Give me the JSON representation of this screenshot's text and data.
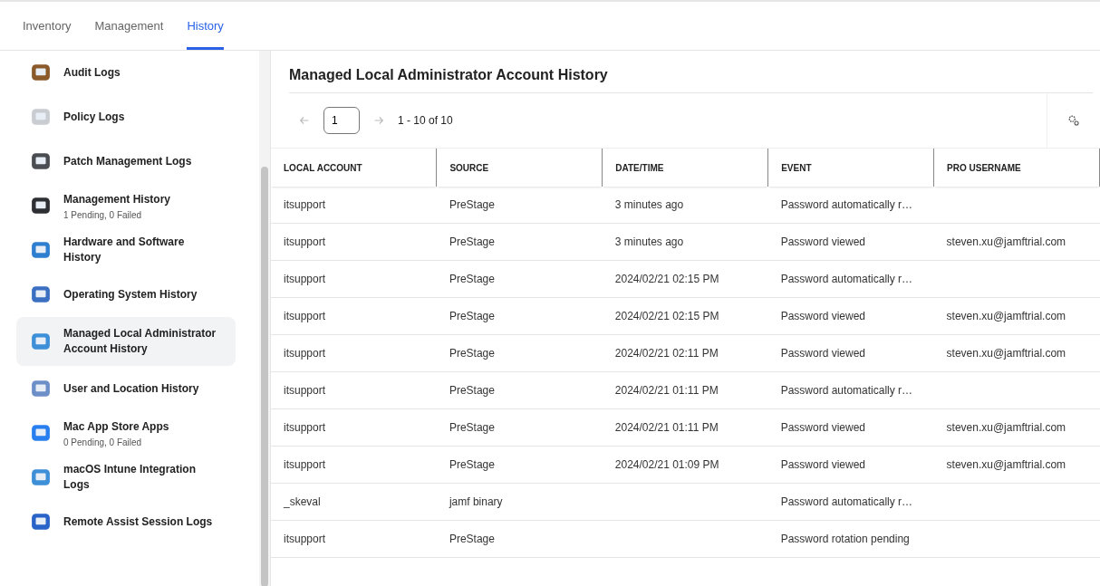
{
  "tabs": [
    {
      "label": "Inventory",
      "selected": false
    },
    {
      "label": "Management",
      "selected": false
    },
    {
      "label": "History",
      "selected": true
    }
  ],
  "sidebar": {
    "items": [
      {
        "label": "Audit Logs",
        "selected": false
      },
      {
        "label": "Policy Logs",
        "selected": false
      },
      {
        "label": "Patch Management Logs",
        "selected": false
      },
      {
        "label": "Management History",
        "subtitle": "1 Pending, 0 Failed",
        "selected": false
      },
      {
        "label": "Hardware and Software History",
        "selected": false
      },
      {
        "label": "Operating System History",
        "selected": false
      },
      {
        "label": "Managed Local Administrator Account History",
        "selected": true
      },
      {
        "label": "User and Location History",
        "selected": false
      },
      {
        "label": "Mac App Store Apps",
        "subtitle": "0 Pending, 0 Failed",
        "selected": false
      },
      {
        "label": "macOS Intune Integration Logs",
        "selected": false
      },
      {
        "label": "Remote Assist Session Logs",
        "selected": false
      }
    ]
  },
  "page_title": "Managed Local Administrator Account History",
  "pagination": {
    "page": "1",
    "range": "1 - 10 of 10"
  },
  "table": {
    "columns": [
      "LOCAL ACCOUNT",
      "SOURCE",
      "DATE/TIME",
      "EVENT",
      "PRO USERNAME"
    ],
    "rows": [
      [
        "itsupport",
        "PreStage",
        "3 minutes ago",
        "Password automatically r…",
        ""
      ],
      [
        "itsupport",
        "PreStage",
        "3 minutes ago",
        "Password viewed",
        "steven.xu@jamftrial.com"
      ],
      [
        "itsupport",
        "PreStage",
        "2024/02/21 02:15 PM",
        "Password automatically r…",
        ""
      ],
      [
        "itsupport",
        "PreStage",
        "2024/02/21 02:15 PM",
        "Password viewed",
        "steven.xu@jamftrial.com"
      ],
      [
        "itsupport",
        "PreStage",
        "2024/02/21 02:11 PM",
        "Password viewed",
        "steven.xu@jamftrial.com"
      ],
      [
        "itsupport",
        "PreStage",
        "2024/02/21 01:11 PM",
        "Password automatically r…",
        ""
      ],
      [
        "itsupport",
        "PreStage",
        "2024/02/21 01:11 PM",
        "Password viewed",
        "steven.xu@jamftrial.com"
      ],
      [
        "itsupport",
        "PreStage",
        "2024/02/21 01:09 PM",
        "Password viewed",
        "steven.xu@jamftrial.com"
      ],
      [
        "_skeval",
        "jamf binary",
        "",
        "Password automatically r…",
        ""
      ],
      [
        "itsupport",
        "PreStage",
        "",
        "Password rotation pending",
        ""
      ]
    ]
  }
}
